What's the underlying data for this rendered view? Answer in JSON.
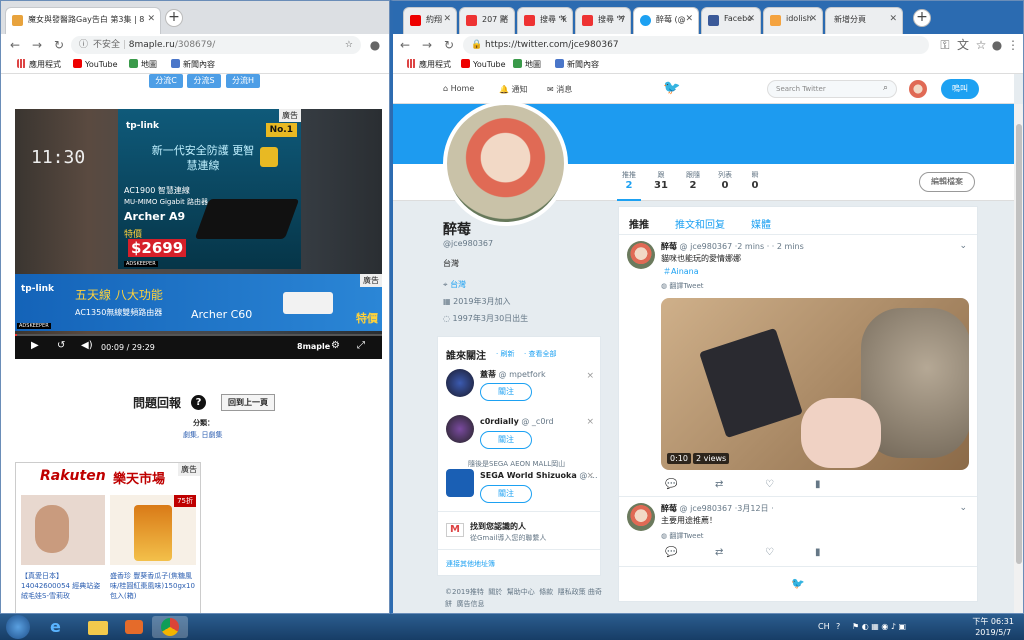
{
  "left_window": {
    "tab_title": "魔女與發醫路Gay告白 第3集 | 8",
    "url_prefix": "不安全",
    "url_host": "8maple.ru",
    "url_path": "/308679/",
    "bookmarks": [
      "應用程式",
      "YouTube",
      "地圖",
      "新聞內容"
    ],
    "stream_buttons": [
      "分流C",
      "分流S",
      "分流H"
    ],
    "video": {
      "clock_text": "11:30",
      "ad1": {
        "tag": "廣告",
        "brand": "tp-link",
        "badge": "No.1",
        "headline": "新一代安全防護 更智慧連線",
        "spec1": "AC1900 智慧連線",
        "spec2": "MU-MIMO Gigabit 路由器",
        "model": "Archer A9",
        "price_label": "特價",
        "price": "$2699",
        "keeper": "ADSKEEPER"
      },
      "ad2": {
        "tag": "廣告",
        "brand": "tp-link",
        "headline": "五天線 八大功能",
        "spec": "AC1350無線雙頻路由器",
        "model": "Archer C60",
        "price_label": "特價",
        "keeper": "ADSKEEPER"
      },
      "time": "00:09 / 29:29",
      "watermark": "8maple",
      "progress_fraction": 0.005
    },
    "feedback": {
      "title": "問題回報",
      "back_button": "回到上一頁",
      "category_label": "分類：",
      "category_value": "劇集, 日劇集"
    },
    "rakuten": {
      "tag": "廣告",
      "brand": "Rakuten",
      "brand_cn": "樂天市場",
      "discount": "75折",
      "item1": "【真愛日本】14042600054 經典站姿絨毛娃S-雪莉玫",
      "item2": "盛香珍 豐葵香瓜子(焦糖風味/桂圓紅棗風味)150gx10包入(箱)"
    }
  },
  "right_window": {
    "tabs": [
      "約翔",
      "207 點",
      "搜尋 \"k",
      "搜尋 \"7",
      "醉莓 (@",
      "Facebo",
      "idolish",
      "新增分頁"
    ],
    "url": "https://twitter.com/jce980367",
    "bookmarks": [
      "應用程式",
      "YouTube",
      "地圖",
      "新聞內容"
    ]
  },
  "twitter": {
    "nav": {
      "home": "Home",
      "notifications": "通知",
      "messages": "消息",
      "search_placeholder": "Search Twitter",
      "tweet_button": "嗚叫"
    },
    "stats": [
      {
        "label": "推推",
        "value": "2"
      },
      {
        "label": "跟",
        "value": "31"
      },
      {
        "label": "跟隨",
        "value": "2"
      },
      {
        "label": "列表",
        "value": "0"
      },
      {
        "label": "瞬",
        "value": "0"
      }
    ],
    "edit_profile": "編輯檔案",
    "profile": {
      "name": "醉莓",
      "handle": "@jce980367",
      "location_text": "台灣",
      "location_link": "台灣",
      "joined": "2019年3月加入",
      "birthday": "1997年3月30日出生"
    },
    "who_to_follow": {
      "title": "誰來關注",
      "refresh": "· 刷新",
      "view_all": "· 查看全部",
      "follow_label": "關注",
      "users": [
        {
          "name": "蓋蒂",
          "handle": "@ mpetfork"
        },
        {
          "name": "c0rdially",
          "handle": "@ _c0rd"
        },
        {
          "name": "SEGA World Shizuoka",
          "handle": "@ ...",
          "context": "隨後是SEGA AEON MALL岡山"
        }
      ]
    },
    "find_people": {
      "title": "找到您認識的人",
      "subtitle": "從Gmail導入您的聯繫人",
      "link": "連接其他地址簿"
    },
    "footer": [
      "©2019推特",
      "關於",
      "幫助中心",
      "條款",
      "隱私政策",
      "曲奇餅",
      "廣告信息"
    ],
    "tabs": [
      "推推",
      "推文和回复",
      "媒體"
    ],
    "tweets": [
      {
        "name": "醉莓",
        "handle": "@ jce980367",
        "time": "·2 mins · · 2 mins",
        "text": "貓咪也能玩的愛情娜娜",
        "hashtag": "＃Ainana",
        "translate": "翻譯Tweet",
        "video_time": "0:10",
        "views": "2 views"
      },
      {
        "name": "醉莓",
        "handle": "@ jce980367",
        "time": "·3月12日 ·",
        "text": "主要用途推薦！",
        "translate": "翻譯Tweet"
      }
    ]
  },
  "taskbar": {
    "ime": "CH",
    "time": "下午 06:31",
    "date": "2019/5/7"
  }
}
